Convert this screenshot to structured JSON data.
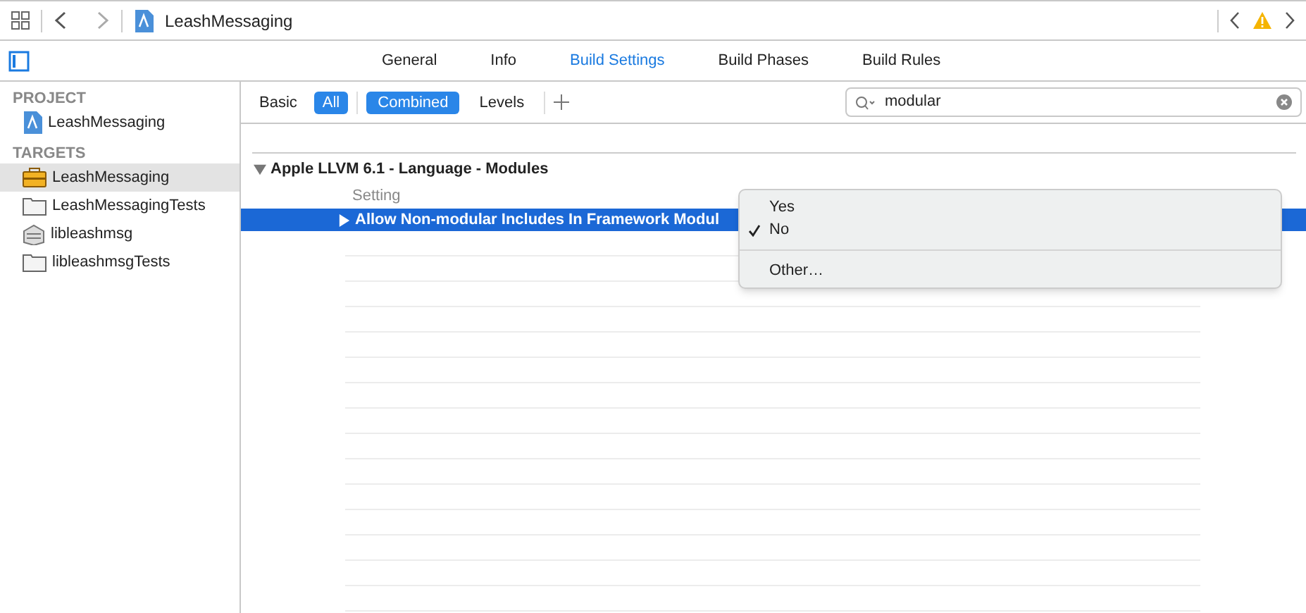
{
  "toolbar": {
    "breadcrumb": "LeashMessaging"
  },
  "tabs": [
    {
      "label": "General",
      "selected": false
    },
    {
      "label": "Info",
      "selected": false
    },
    {
      "label": "Build Settings",
      "selected": true
    },
    {
      "label": "Build Phases",
      "selected": false
    },
    {
      "label": "Build Rules",
      "selected": false
    }
  ],
  "filters": [
    {
      "label": "Basic",
      "selected": false
    },
    {
      "label": "All",
      "selected": true
    }
  ],
  "views": [
    {
      "label": "Combined",
      "selected": true
    },
    {
      "label": "Levels",
      "selected": false
    }
  ],
  "search": {
    "value": "modular"
  },
  "sidebar": {
    "sections": [
      {
        "title": "PROJECT",
        "items": [
          {
            "label": "LeashMessaging",
            "kind": "project",
            "selected": false
          }
        ]
      },
      {
        "title": "TARGETS",
        "items": [
          {
            "label": "LeashMessaging",
            "kind": "app",
            "selected": true
          },
          {
            "label": "LeashMessagingTests",
            "kind": "bundle",
            "selected": false
          },
          {
            "label": "libleashmsg",
            "kind": "library",
            "selected": false
          },
          {
            "label": "libleashmsgTests",
            "kind": "bundle",
            "selected": false
          }
        ]
      }
    ]
  },
  "settings_group": {
    "title": "Apple LLVM 6.1 - Language - Modules",
    "expanded": true,
    "column_1": "Setting",
    "rows": [
      {
        "name": "Allow Non-modular Includes In Framework Modul",
        "selected": true,
        "expanded": false
      }
    ]
  },
  "popup_menu": {
    "options": [
      {
        "label": "Yes",
        "checked": false
      },
      {
        "label": "No",
        "checked": true
      }
    ],
    "other": "Other…"
  }
}
